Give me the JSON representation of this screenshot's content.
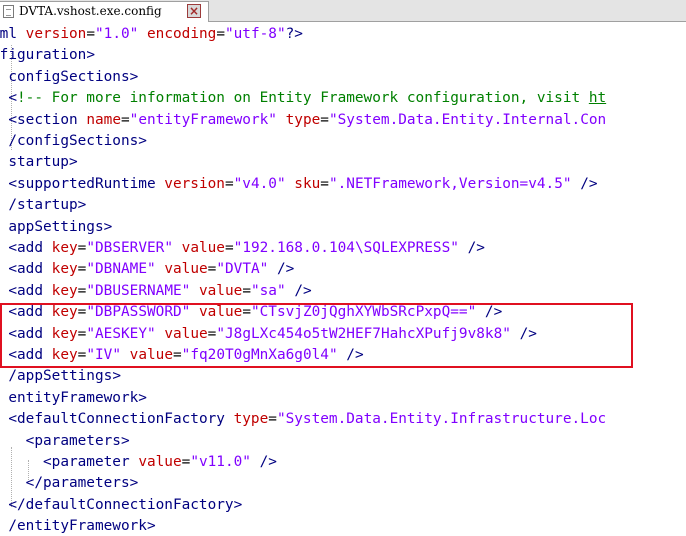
{
  "tab": {
    "label": "DVTA.vshost.exe.config"
  },
  "colors": {
    "tag": "#000080",
    "attribute": "#c00000",
    "value": "#8000ff",
    "comment": "#008000",
    "highlight": "#e01020"
  },
  "icons": {
    "file": "document-icon",
    "close": "close-icon"
  },
  "lines": [
    [
      [
        "tag",
        "xml"
      ],
      [
        "t",
        " "
      ],
      [
        "attr",
        "version"
      ],
      [
        "eq",
        "="
      ],
      [
        "val",
        "\"1.0\""
      ],
      [
        "t",
        " "
      ],
      [
        "attr",
        "encoding"
      ],
      [
        "eq",
        "="
      ],
      [
        "val",
        "\"utf-8\""
      ],
      [
        "bracket",
        "?>"
      ]
    ],
    [
      [
        "tag",
        "nfiguration"
      ],
      [
        "bracket",
        ">"
      ]
    ],
    [
      [
        "t",
        "  "
      ],
      [
        "tag",
        "configSections"
      ],
      [
        "bracket",
        ">"
      ]
    ],
    [
      [
        "t",
        "  "
      ],
      [
        "bracket",
        "<"
      ],
      [
        "comment",
        "!-- For more information on Entity Framework configuration, visit "
      ],
      [
        "commentlink",
        "ht"
      ]
    ],
    [
      [
        "t",
        "  "
      ],
      [
        "bracket",
        "<"
      ],
      [
        "tag",
        "section"
      ],
      [
        "t",
        " "
      ],
      [
        "attr",
        "name"
      ],
      [
        "eq",
        "="
      ],
      [
        "val",
        "\"entityFramework\""
      ],
      [
        "t",
        " "
      ],
      [
        "attr",
        "type"
      ],
      [
        "eq",
        "="
      ],
      [
        "val",
        "\"System.Data.Entity.Internal.Con"
      ]
    ],
    [
      [
        "t",
        "  "
      ],
      [
        "bracket",
        "/"
      ],
      [
        "tag",
        "configSections"
      ],
      [
        "bracket",
        ">"
      ]
    ],
    [
      [
        "t",
        "  "
      ],
      [
        "tag",
        "startup"
      ],
      [
        "bracket",
        ">"
      ]
    ],
    [
      [
        "t",
        "  "
      ],
      [
        "bracket",
        "<"
      ],
      [
        "tag",
        "supportedRuntime"
      ],
      [
        "t",
        " "
      ],
      [
        "attr",
        "version"
      ],
      [
        "eq",
        "="
      ],
      [
        "val",
        "\"v4.0\""
      ],
      [
        "t",
        " "
      ],
      [
        "attr",
        "sku"
      ],
      [
        "eq",
        "="
      ],
      [
        "val",
        "\".NETFramework,Version=v4.5\""
      ],
      [
        "t",
        " "
      ],
      [
        "bracket",
        "/>"
      ]
    ],
    [
      [
        "t",
        "  "
      ],
      [
        "bracket",
        "/"
      ],
      [
        "tag",
        "startup"
      ],
      [
        "bracket",
        ">"
      ]
    ],
    [
      [
        "t",
        "  "
      ],
      [
        "tag",
        "appSettings"
      ],
      [
        "bracket",
        ">"
      ]
    ],
    [
      [
        "t",
        "  "
      ],
      [
        "bracket",
        "<"
      ],
      [
        "tag",
        "add"
      ],
      [
        "t",
        " "
      ],
      [
        "attr",
        "key"
      ],
      [
        "eq",
        "="
      ],
      [
        "val",
        "\"DBSERVER\""
      ],
      [
        "t",
        " "
      ],
      [
        "attr",
        "value"
      ],
      [
        "eq",
        "="
      ],
      [
        "val",
        "\"192.168.0.104\\SQLEXPRESS\""
      ],
      [
        "t",
        " "
      ],
      [
        "bracket",
        "/>"
      ]
    ],
    [
      [
        "t",
        "  "
      ],
      [
        "bracket",
        "<"
      ],
      [
        "tag",
        "add"
      ],
      [
        "t",
        " "
      ],
      [
        "attr",
        "key"
      ],
      [
        "eq",
        "="
      ],
      [
        "val",
        "\"DBNAME\""
      ],
      [
        "t",
        " "
      ],
      [
        "attr",
        "value"
      ],
      [
        "eq",
        "="
      ],
      [
        "val",
        "\"DVTA\""
      ],
      [
        "t",
        " "
      ],
      [
        "bracket",
        "/>"
      ]
    ],
    [
      [
        "t",
        "  "
      ],
      [
        "bracket",
        "<"
      ],
      [
        "tag",
        "add"
      ],
      [
        "t",
        " "
      ],
      [
        "attr",
        "key"
      ],
      [
        "eq",
        "="
      ],
      [
        "val",
        "\"DBUSERNAME\""
      ],
      [
        "t",
        " "
      ],
      [
        "attr",
        "value"
      ],
      [
        "eq",
        "="
      ],
      [
        "val",
        "\"sa\""
      ],
      [
        "t",
        " "
      ],
      [
        "bracket",
        "/>"
      ]
    ],
    [
      [
        "t",
        "  "
      ],
      [
        "bracket",
        "<"
      ],
      [
        "tag",
        "add"
      ],
      [
        "t",
        " "
      ],
      [
        "attr",
        "key"
      ],
      [
        "eq",
        "="
      ],
      [
        "val",
        "\"DBPASSWORD\""
      ],
      [
        "t",
        " "
      ],
      [
        "attr",
        "value"
      ],
      [
        "eq",
        "="
      ],
      [
        "val",
        "\"CTsvjZ0jQghXYWbSRcPxpQ==\""
      ],
      [
        "t",
        " "
      ],
      [
        "bracket",
        "/>"
      ]
    ],
    [
      [
        "t",
        "  "
      ],
      [
        "bracket",
        "<"
      ],
      [
        "tag",
        "add"
      ],
      [
        "t",
        " "
      ],
      [
        "attr",
        "key"
      ],
      [
        "eq",
        "="
      ],
      [
        "val",
        "\"AESKEY\""
      ],
      [
        "t",
        " "
      ],
      [
        "attr",
        "value"
      ],
      [
        "eq",
        "="
      ],
      [
        "val",
        "\"J8gLXc454o5tW2HEF7HahcXPufj9v8k8\""
      ],
      [
        "t",
        " "
      ],
      [
        "bracket",
        "/>"
      ]
    ],
    [
      [
        "t",
        "  "
      ],
      [
        "bracket",
        "<"
      ],
      [
        "tag",
        "add"
      ],
      [
        "t",
        " "
      ],
      [
        "attr",
        "key"
      ],
      [
        "eq",
        "="
      ],
      [
        "val",
        "\"IV\""
      ],
      [
        "t",
        " "
      ],
      [
        "attr",
        "value"
      ],
      [
        "eq",
        "="
      ],
      [
        "val",
        "\"fq20T0gMnXa6g0l4\""
      ],
      [
        "t",
        " "
      ],
      [
        "bracket",
        "/>"
      ]
    ],
    [
      [
        "t",
        "  "
      ],
      [
        "bracket",
        "/"
      ],
      [
        "tag",
        "appSettings"
      ],
      [
        "bracket",
        ">"
      ]
    ],
    [
      [
        "t",
        "  "
      ],
      [
        "tag",
        "entityFramework"
      ],
      [
        "bracket",
        ">"
      ]
    ],
    [
      [
        "t",
        "  "
      ],
      [
        "bracket",
        "<"
      ],
      [
        "tag",
        "defaultConnectionFactory"
      ],
      [
        "t",
        " "
      ],
      [
        "attr",
        "type"
      ],
      [
        "eq",
        "="
      ],
      [
        "val",
        "\"System.Data.Entity.Infrastructure.Loc"
      ]
    ],
    [
      [
        "t",
        "    "
      ],
      [
        "bracket",
        "<"
      ],
      [
        "tag",
        "parameters"
      ],
      [
        "bracket",
        ">"
      ]
    ],
    [
      [
        "t",
        "      "
      ],
      [
        "bracket",
        "<"
      ],
      [
        "tag",
        "parameter"
      ],
      [
        "t",
        " "
      ],
      [
        "attr",
        "value"
      ],
      [
        "eq",
        "="
      ],
      [
        "val",
        "\"v11.0\""
      ],
      [
        "t",
        " "
      ],
      [
        "bracket",
        "/>"
      ]
    ],
    [
      [
        "t",
        "    "
      ],
      [
        "bracket",
        "</"
      ],
      [
        "tag",
        "parameters"
      ],
      [
        "bracket",
        ">"
      ]
    ],
    [
      [
        "t",
        "  "
      ],
      [
        "bracket",
        "</"
      ],
      [
        "tag",
        "defaultConnectionFactory"
      ],
      [
        "bracket",
        ">"
      ]
    ],
    [
      [
        "t",
        "  "
      ],
      [
        "bracket",
        "/"
      ],
      [
        "tag",
        "entityFramework"
      ],
      [
        "bracket",
        ">"
      ]
    ]
  ]
}
